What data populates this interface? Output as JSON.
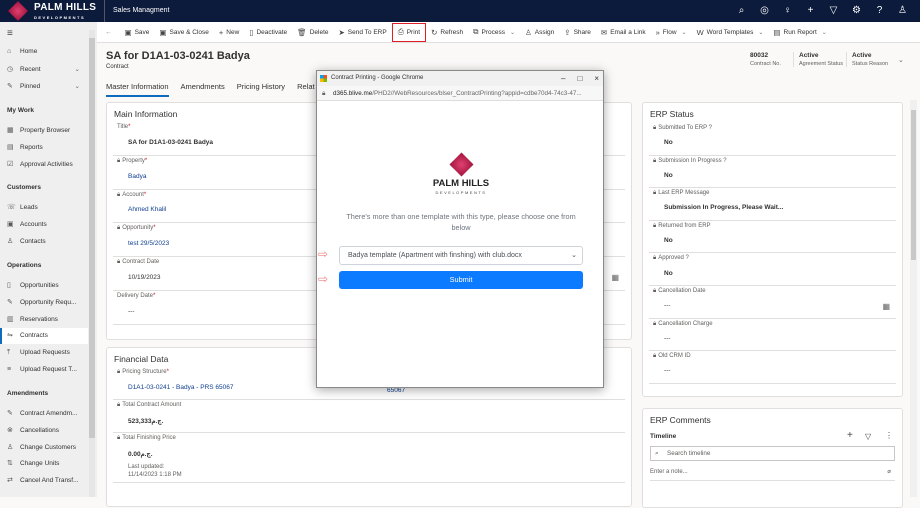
{
  "topbar": {
    "brand": "PALM HILLS",
    "brand_sub": "DEVELOPMENTS",
    "app_name": "Sales Managment",
    "icons": [
      "search-icon",
      "target-icon",
      "lightbulb-icon",
      "plus-icon",
      "filter-icon",
      "settings-icon",
      "help-icon",
      "user-icon"
    ]
  },
  "sidebar": {
    "top": [
      {
        "label": "Home",
        "icon": "⌂"
      },
      {
        "label": "Recent",
        "icon": "◷"
      },
      {
        "label": "Pinned",
        "icon": "✎"
      }
    ],
    "sections": [
      {
        "title": "My Work",
        "items": [
          {
            "label": "Property Browser",
            "icon": "▦"
          },
          {
            "label": "Reports",
            "icon": "▤"
          },
          {
            "label": "Approval Activities",
            "icon": "☑"
          }
        ]
      },
      {
        "title": "Customers",
        "items": [
          {
            "label": "Leads",
            "icon": "☏"
          },
          {
            "label": "Accounts",
            "icon": "▣"
          },
          {
            "label": "Contacts",
            "icon": "♙"
          }
        ]
      },
      {
        "title": "Operations",
        "items": [
          {
            "label": "Opportunities",
            "icon": "▯"
          },
          {
            "label": "Opportunity Requ...",
            "icon": "✎"
          },
          {
            "label": "Reservations",
            "icon": "▥"
          },
          {
            "label": "Contracts",
            "icon": "⇋"
          },
          {
            "label": "Upload Requests",
            "icon": "⤒"
          },
          {
            "label": "Upload Request T...",
            "icon": "≡"
          }
        ]
      },
      {
        "title": "Amendments",
        "items": [
          {
            "label": "Contract Amendm...",
            "icon": "✎"
          },
          {
            "label": "Cancellations",
            "icon": "⊗"
          },
          {
            "label": "Change Customers",
            "icon": "♙"
          },
          {
            "label": "Change Units",
            "icon": "⇅"
          },
          {
            "label": "Cancel And Transf...",
            "icon": "⇄"
          }
        ]
      }
    ]
  },
  "commands": [
    {
      "label": "Save",
      "icon": "▣"
    },
    {
      "label": "Save & Close",
      "icon": "▣"
    },
    {
      "label": "New",
      "icon": "+"
    },
    {
      "label": "Deactivate",
      "icon": "▯"
    },
    {
      "label": "Delete",
      "icon": "🗑"
    },
    {
      "label": "Send To ERP",
      "icon": "➤"
    },
    {
      "label": "Print",
      "icon": "⎙"
    },
    {
      "label": "Refresh",
      "icon": "↻"
    },
    {
      "label": "Process",
      "icon": "⧉",
      "dropdown": true
    },
    {
      "label": "Assign",
      "icon": "♙"
    },
    {
      "label": "Share",
      "icon": "⇪"
    },
    {
      "label": "Email a Link",
      "icon": "✉"
    },
    {
      "label": "Flow",
      "icon": "»",
      "dropdown": true
    },
    {
      "label": "Word Templates",
      "icon": "W",
      "dropdown": true
    },
    {
      "label": "Run Report",
      "icon": "▤",
      "dropdown": true
    }
  ],
  "record": {
    "title": "SA for D1A1-03-0241 Badya",
    "entity": "Contract",
    "header_fields": [
      {
        "value": "80032",
        "label": "Contract No."
      },
      {
        "value": "Active",
        "label": "Agreement Status"
      },
      {
        "value": "Active",
        "label": "Status Reason"
      }
    ]
  },
  "tabs": [
    "Master Information",
    "Amendments",
    "Pricing History",
    "Relat"
  ],
  "main_info": {
    "title": "Main Information",
    "fields": [
      {
        "label": "Title",
        "value": "SA for D1A1-03-0241 Badya"
      },
      {
        "label": "Property",
        "value": "Badya"
      },
      {
        "label": "Account",
        "value": "Ahmed Khalil"
      },
      {
        "label": "Opportunity",
        "value": "test 29/5/2023"
      },
      {
        "label": "Contract Date",
        "value": "10/19/2023"
      },
      {
        "label": "Delivery Date",
        "value": "---"
      }
    ]
  },
  "financial": {
    "title": "Financial Data",
    "fields": [
      {
        "label": "Pricing Structure",
        "value": "D1A1-03-0241 - Badya - PRS 65067"
      },
      {
        "label": "Total Contract Amount",
        "value": "523,333ج.م."
      },
      {
        "label": "Total Finishing Price",
        "value": "0.00ج.م.",
        "last_updated_label": "Last updated:",
        "last_updated": "11/14/2023 1:18 PM"
      }
    ],
    "partial_value": "65067"
  },
  "erp_status": {
    "title": "ERP Status",
    "fields": [
      {
        "label": "Submitted To ERP ?",
        "value": "No"
      },
      {
        "label": "Submission In Progress ?",
        "value": "No"
      },
      {
        "label": "Last ERP Message",
        "value": "Submission In Progress, Please Wait..."
      },
      {
        "label": "Returned from ERP",
        "value": "No"
      },
      {
        "label": "Approved ?",
        "value": "No"
      },
      {
        "label": "Cancellation Date",
        "value": "---"
      },
      {
        "label": "Cancellation Charge",
        "value": "---"
      },
      {
        "label": "Old CRM ID",
        "value": "---"
      }
    ]
  },
  "erp_comments": {
    "title": "ERP Comments",
    "timeline": "Timeline",
    "search_placeholder": "Search timeline",
    "note_placeholder": "Enter a note..."
  },
  "popup": {
    "window_title": "Contract Printing - Google Chrome",
    "url_host": "d365.blive.me",
    "url_path": "/PHD2//WebResources/blser_ContractPrinting?appid=cdbe70d4-74c3-47...",
    "brand": "PALM HILLS",
    "brand_sub": "DEVELOPMENTS",
    "message": "There's more than one template with this type, please choose one from below",
    "selected_template": "Badya template (Apartment with finshing) with club.docx",
    "submit_label": "Submit"
  }
}
